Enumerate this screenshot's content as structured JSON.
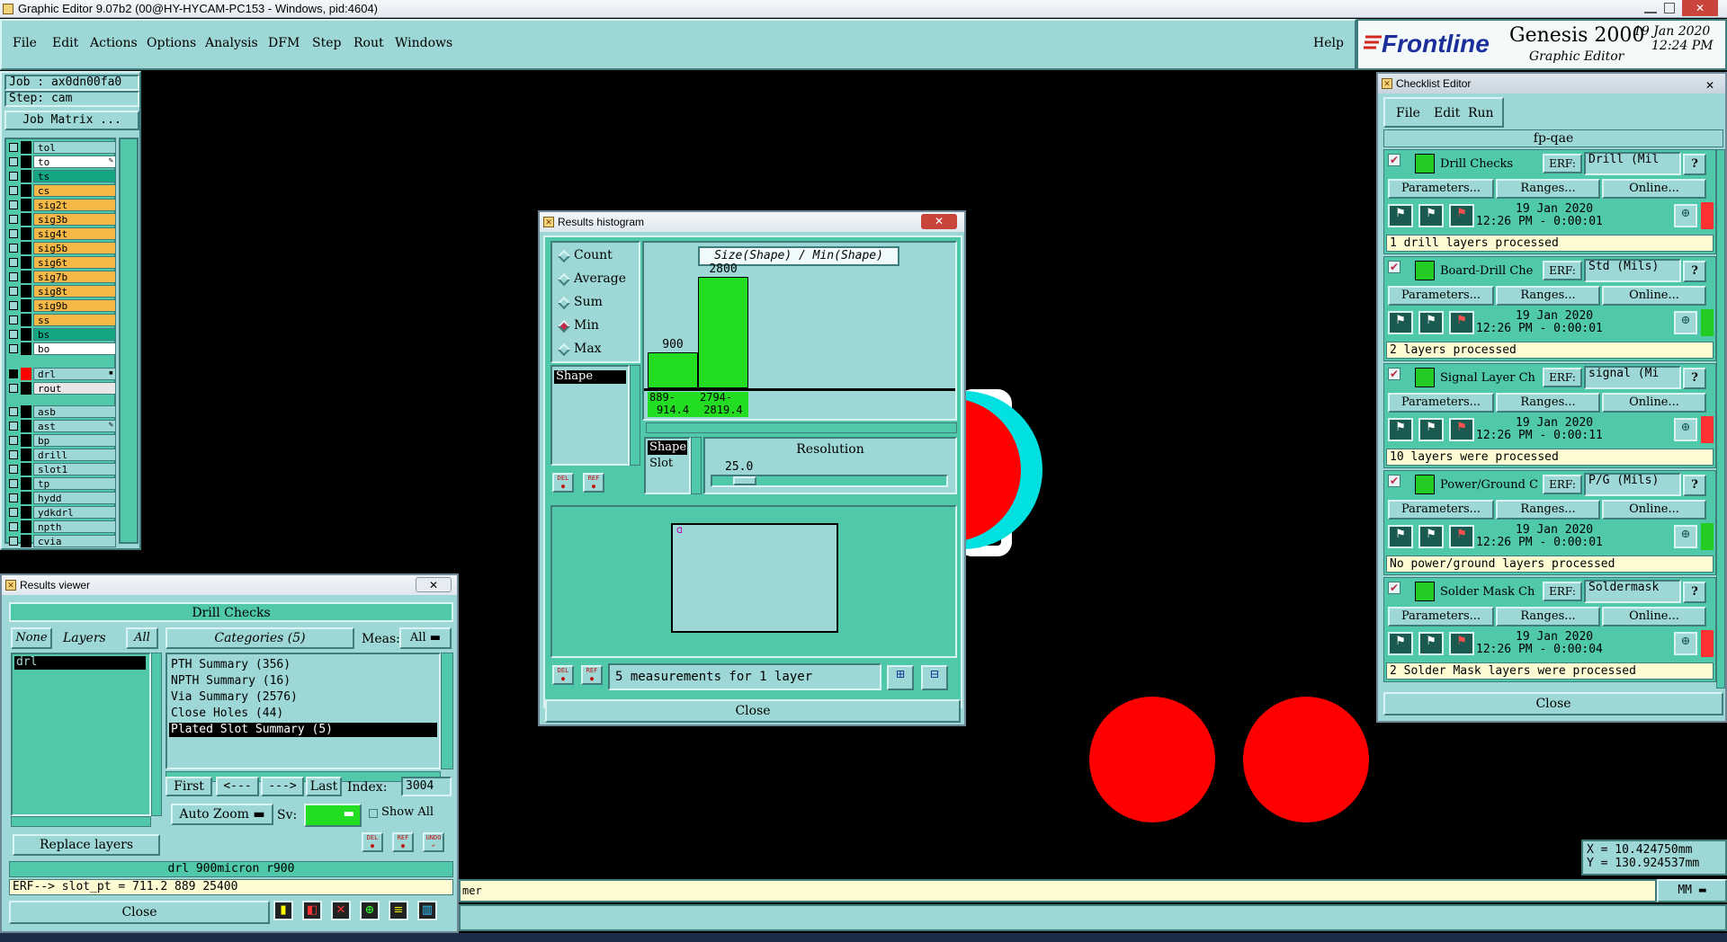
{
  "window_title": "Graphic Editor 9.07b2 (00@HY-HYCAM-PC153 - Windows, pid:4604)",
  "menu": [
    "File",
    "Edit",
    "Actions",
    "Options",
    "Analysis",
    "DFM",
    "Step",
    "Rout",
    "Windows"
  ],
  "help": "Help",
  "brand": {
    "logo": "Frontline",
    "product": "Genesis 2000",
    "subtitle": "Graphic Editor",
    "date": "19 Jan 2020",
    "time": "12:24 PM"
  },
  "job": {
    "job_label": "Job : ax0dn00fa0",
    "step_label": "Step: cam",
    "matrix_button": "Job Matrix ..."
  },
  "layers": {
    "group1": [
      {
        "name": "tol",
        "color": "#9ed8d6",
        "swatch": "#000000",
        "on": false,
        "mark": ""
      },
      {
        "name": "to",
        "color": "#ffffff",
        "swatch": "#000000",
        "on": false,
        "mark": "✎"
      },
      {
        "name": "ts",
        "color": "#15a783",
        "swatch": "#000000",
        "on": false,
        "mark": ""
      },
      {
        "name": "cs",
        "color": "#f5b847",
        "swatch": "#000000",
        "on": false,
        "mark": ""
      },
      {
        "name": "sig2t",
        "color": "#f5b847",
        "swatch": "#000000",
        "on": false,
        "mark": ""
      },
      {
        "name": "sig3b",
        "color": "#f5b847",
        "swatch": "#000000",
        "on": false,
        "mark": ""
      },
      {
        "name": "sig4t",
        "color": "#f5b847",
        "swatch": "#000000",
        "on": false,
        "mark": ""
      },
      {
        "name": "sig5b",
        "color": "#f5b847",
        "swatch": "#000000",
        "on": false,
        "mark": ""
      },
      {
        "name": "sig6t",
        "color": "#f5b847",
        "swatch": "#000000",
        "on": false,
        "mark": ""
      },
      {
        "name": "sig7b",
        "color": "#f5b847",
        "swatch": "#000000",
        "on": false,
        "mark": ""
      },
      {
        "name": "sig8t",
        "color": "#f5b847",
        "swatch": "#000000",
        "on": false,
        "mark": ""
      },
      {
        "name": "sig9b",
        "color": "#f5b847",
        "swatch": "#000000",
        "on": false,
        "mark": ""
      },
      {
        "name": "ss",
        "color": "#f5b847",
        "swatch": "#000000",
        "on": false,
        "mark": ""
      },
      {
        "name": "bs",
        "color": "#15a783",
        "swatch": "#000000",
        "on": false,
        "mark": ""
      },
      {
        "name": "bo",
        "color": "#ffffff",
        "swatch": "#000000",
        "on": false,
        "mark": ""
      }
    ],
    "group2": [
      {
        "name": "drl",
        "color": "#9ed8d6",
        "swatch": "#ff0000",
        "on": true,
        "mark": "▪"
      },
      {
        "name": "rout",
        "color": "#e6e6e6",
        "swatch": "#000000",
        "on": false,
        "mark": ""
      }
    ],
    "group3": [
      {
        "name": "asb",
        "color": "#9ed8d6",
        "swatch": "#000000",
        "on": false,
        "mark": ""
      },
      {
        "name": "ast",
        "color": "#9ed8d6",
        "swatch": "#000000",
        "on": false,
        "mark": "✎"
      },
      {
        "name": "bp",
        "color": "#9ed8d6",
        "swatch": "#000000",
        "on": false,
        "mark": ""
      },
      {
        "name": "drill",
        "color": "#9ed8d6",
        "swatch": "#000000",
        "on": false,
        "mark": ""
      },
      {
        "name": "slot1",
        "color": "#9ed8d6",
        "swatch": "#000000",
        "on": false,
        "mark": ""
      },
      {
        "name": "tp",
        "color": "#9ed8d6",
        "swatch": "#000000",
        "on": false,
        "mark": ""
      },
      {
        "name": "hydd",
        "color": "#9ed8d6",
        "swatch": "#000000",
        "on": false,
        "mark": ""
      },
      {
        "name": "ydkdrl",
        "color": "#9ed8d6",
        "swatch": "#000000",
        "on": false,
        "mark": ""
      },
      {
        "name": "npth",
        "color": "#9ed8d6",
        "swatch": "#000000",
        "on": false,
        "mark": ""
      },
      {
        "name": "cvia",
        "color": "#9ed8d6",
        "swatch": "#000000",
        "on": false,
        "mark": ""
      }
    ]
  },
  "results_viewer": {
    "title": "Results viewer",
    "header": "Drill Checks",
    "none_btn": "None",
    "layers_label": "Layers",
    "all_btn": "All",
    "layer_items": [
      "drl"
    ],
    "categories_label": "Categories (5)",
    "meas_label": "Meas:",
    "meas_value": "All",
    "categories": [
      "PTH Summary (356)",
      "NPTH Summary (16)",
      "Via Summary (2576)",
      "Close Holes (44)",
      "Plated Slot Summary (5)"
    ],
    "selected_category": 4,
    "nav": {
      "first": "First",
      "prev": "<---",
      "next": "--->",
      "last": "Last",
      "index_label": "Index:",
      "index_value": "3004"
    },
    "auto_zoom": "Auto Zoom",
    "sv_label": "Sv:",
    "show_all": "Show All",
    "del": "DEL",
    "ref": "REF",
    "undo": "UNDO",
    "replace_layers": "Replace layers",
    "status": "drl 900micron  r900",
    "erf_line": "ERF--> slot_pt = 711.2 889 25400",
    "close": "Close"
  },
  "histogram": {
    "title": "Results histogram",
    "modes": [
      "Count",
      "Average",
      "Sum",
      "Min",
      "Max"
    ],
    "selected_mode": 3,
    "list_items": [
      "Shape"
    ],
    "chart_title": "Size(Shape) / Min(Shape)",
    "bars": [
      {
        "value": 900,
        "range_top": "889-",
        "range_bottom": "914.4"
      },
      {
        "value": 2800,
        "range_top": "2794-",
        "range_bottom": "2819.4"
      }
    ],
    "axis_items": [
      "Shape",
      "Slot"
    ],
    "resolution_label": "Resolution",
    "resolution_value": "25.0",
    "resolution_fraction": 0.1,
    "preview_label": "ᗡ",
    "measurements": "5 measurements for 1 layer",
    "del": "DEL",
    "ref": "REF",
    "close": "Close"
  },
  "checklist": {
    "title": "Checklist Editor",
    "menu": [
      "File",
      "Edit",
      "Run"
    ],
    "name": "fp-qae",
    "items": [
      {
        "name": "Drill Checks",
        "icon": "drill-icon",
        "erf": "Drill (Mil",
        "date": "19 Jan 2020",
        "time": "12:26 PM - 0:00:01",
        "status": "#ff3030",
        "message": "1 drill layers processed"
      },
      {
        "name": "Board-Drill Che",
        "icon": "board-drill-icon",
        "erf": "Std (Mils)",
        "date": "19 Jan 2020",
        "time": "12:26 PM - 0:00:01",
        "status": "#22cc22",
        "message": "2 layers processed"
      },
      {
        "name": "Signal Layer Ch",
        "icon": "signal-icon",
        "erf": "signal (Mi",
        "date": "19 Jan 2020",
        "time": "12:26 PM - 0:00:11",
        "status": "#ff3030",
        "message": "10 layers were processed"
      },
      {
        "name": "Power/Ground C",
        "icon": "power-ground-icon",
        "erf": "P/G (Mils)",
        "date": "19 Jan 2020",
        "time": "12:26 PM - 0:00:01",
        "status": "#22cc22",
        "message": "No power/ground layers processed"
      },
      {
        "name": "Solder Mask Ch",
        "icon": "solder-mask-icon",
        "erf": "Soldermask",
        "date": "19 Jan 2020",
        "time": "12:26 PM - 0:00:04",
        "status": "#ff3030",
        "message": "2 Solder Mask layers were processed"
      }
    ],
    "erf_label": "ERF:",
    "params_btn": "Parameters...",
    "ranges_btn": "Ranges...",
    "online_btn": "Online...",
    "close": "Close"
  },
  "coords": {
    "x": "X = 10.424750mm",
    "y": "Y = 130.924537mm"
  },
  "unit": "MM",
  "message_bar": "mer"
}
